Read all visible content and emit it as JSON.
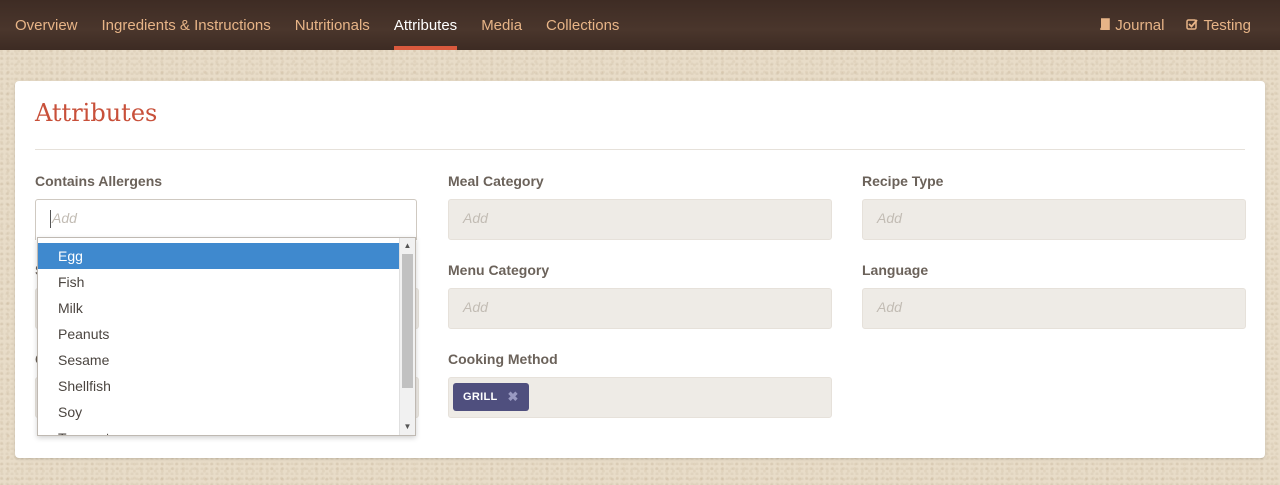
{
  "nav": {
    "tabs": [
      {
        "label": "Overview"
      },
      {
        "label": "Ingredients & Instructions"
      },
      {
        "label": "Nutritionals"
      },
      {
        "label": "Attributes"
      },
      {
        "label": "Media"
      },
      {
        "label": "Collections"
      }
    ],
    "right": [
      {
        "label": "Journal",
        "icon": "book-icon"
      },
      {
        "label": "Testing",
        "icon": "checkbox-icon"
      }
    ]
  },
  "page": {
    "title": "Attributes"
  },
  "fields": {
    "allergens": {
      "label": "Contains Allergens",
      "placeholder": "Add"
    },
    "meal_category": {
      "label": "Meal Category",
      "placeholder": "Add"
    },
    "recipe_type": {
      "label": "Recipe Type",
      "placeholder": "Add"
    },
    "menu_category": {
      "label": "Menu Category",
      "placeholder": "Add"
    },
    "language": {
      "label": "Language",
      "placeholder": "Add"
    },
    "cooking_method": {
      "label": "Cooking Method",
      "chip": "GRILL"
    }
  },
  "dropdown": {
    "options": [
      "Egg",
      "Fish",
      "Milk",
      "Peanuts",
      "Sesame",
      "Shellfish",
      "Soy",
      "Tree nuts"
    ],
    "highlighted": "Egg"
  },
  "colors": {
    "accent": "#c8503a",
    "nav_bg": "#3e2c24",
    "nav_text": "#e7b487",
    "chip": "#4f4f7e",
    "highlight": "#3f89ce"
  }
}
